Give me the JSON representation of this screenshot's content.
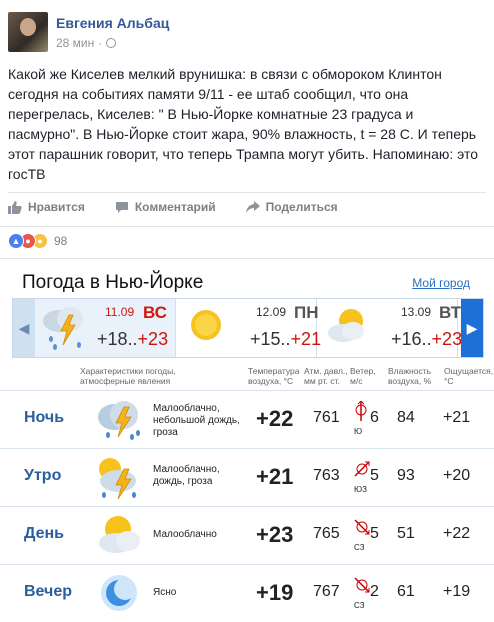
{
  "post": {
    "author": "Евгения Альбац",
    "time": "28 мин",
    "separator": "·",
    "text": "Какой же Киселев мелкий врунишка: в связи с обмороком Клинтон сегодня на событиях памяти 9/11 - ее штаб сообщил, что она перегрелась, Киселев: \" В Нью-Йорке комнатные 23 градуса и пасмурно\". В Нью-Йорке стоит жара, 90% влажность, t = 28 С. И теперь этот парашник говорит, что теперь Трампа могут убить. Напоминаю: это госТВ",
    "actions": {
      "like": "Нравится",
      "comment": "Комментарий",
      "share": "Поделиться"
    },
    "reactions_count": "98"
  },
  "weather": {
    "title": "Погода в Нью-Йорке",
    "link": "Мой город",
    "days": [
      {
        "date": "11.09",
        "dow": "ВС",
        "lo": "+18..",
        "hi": "+23",
        "icon": "thunderstorm-icon"
      },
      {
        "date": "12.09",
        "dow": "ПН",
        "lo": "+15..",
        "hi": "+21",
        "icon": "sun-icon"
      },
      {
        "date": "13.09",
        "dow": "ВТ",
        "lo": "+16..",
        "hi": "+23",
        "icon": "partly-cloudy-icon"
      }
    ],
    "headers": {
      "conditions": "Характеристики погоды, атмосферные явления",
      "temperature": "Температура воздуха, °С",
      "pressure": "Атм. давл., мм рт. ст.",
      "wind": "Ветер, м/с",
      "humidity": "Влажность воздуха, %",
      "feels": "Ощущается, °С"
    },
    "rows": [
      {
        "label": "Ночь",
        "desc": "Малооблачно, небольшой дождь, гроза",
        "temp": "+22",
        "pressure": "761",
        "wind_speed": "6",
        "wind_dir": "Ю",
        "humidity": "84",
        "feels": "+21",
        "icon": "storm-cloud-icon"
      },
      {
        "label": "Утро",
        "desc": "Малооблачно, дождь, гроза",
        "temp": "+21",
        "pressure": "763",
        "wind_speed": "5",
        "wind_dir": "ЮЗ",
        "humidity": "93",
        "feels": "+20",
        "icon": "sun-storm-icon"
      },
      {
        "label": "День",
        "desc": "Малооблачно",
        "temp": "+23",
        "pressure": "765",
        "wind_speed": "5",
        "wind_dir": "СЗ",
        "humidity": "51",
        "feels": "+22",
        "icon": "partly-cloudy-icon"
      },
      {
        "label": "Вечер",
        "desc": "Ясно",
        "temp": "+19",
        "pressure": "767",
        "wind_speed": "2",
        "wind_dir": "СЗ",
        "humidity": "61",
        "feels": "+19",
        "icon": "moon-icon"
      }
    ]
  }
}
